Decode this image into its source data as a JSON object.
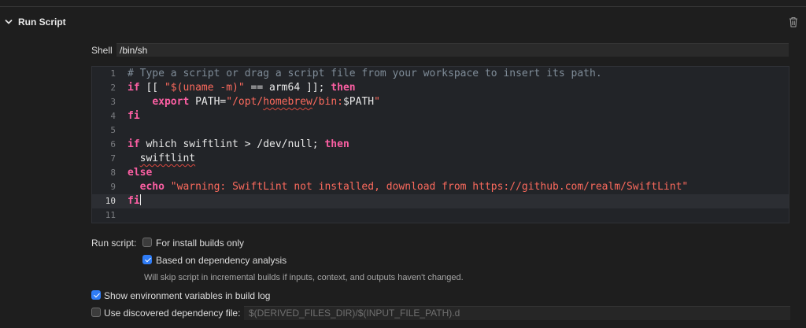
{
  "phase": {
    "title": "Run Script"
  },
  "shell": {
    "label": "Shell",
    "value": "/bin/sh"
  },
  "editor": {
    "current_line": 10,
    "lines": [
      {
        "num": "1",
        "text": "# Type a script or drag a script file from your workspace to insert its path."
      },
      {
        "num": "2",
        "text": "if [[ \"$(uname -m)\" == arm64 ]]; then"
      },
      {
        "num": "3",
        "text": "    export PATH=\"/opt/homebrew/bin:$PATH\""
      },
      {
        "num": "4",
        "text": "fi"
      },
      {
        "num": "5",
        "text": ""
      },
      {
        "num": "6",
        "text": "if which swiftlint > /dev/null; then"
      },
      {
        "num": "7",
        "text": "  swiftlint"
      },
      {
        "num": "8",
        "text": "else"
      },
      {
        "num": "9",
        "text": "  echo \"warning: SwiftLint not installed, download from https://github.com/realm/SwiftLint\""
      },
      {
        "num": "10",
        "text": "fi"
      },
      {
        "num": "11",
        "text": ""
      }
    ]
  },
  "options": {
    "run_script_label": "Run script:",
    "install_builds": {
      "label": "For install builds only",
      "checked": false
    },
    "dependency_analysis": {
      "label": "Based on dependency analysis",
      "checked": true
    },
    "dependency_hint": "Will skip script in incremental builds if inputs, context, and outputs haven't changed.",
    "show_env": {
      "label": "Show environment variables in build log",
      "checked": true
    },
    "discovered_dep": {
      "label": "Use discovered dependency file:",
      "checked": false
    },
    "dep_file_placeholder": "$(DERIVED_FILES_DIR)/$(INPUT_FILE_PATH).d"
  },
  "colors": {
    "accent": "#2f7cf6",
    "keyword": "#fc5fa3",
    "string": "#fc6a5d",
    "comment": "#7f8c98"
  }
}
